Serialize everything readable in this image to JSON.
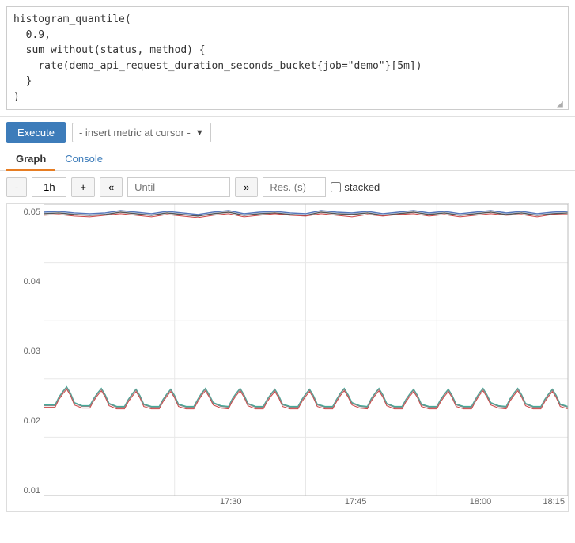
{
  "query": {
    "lines": [
      "histogram_quantile(",
      "  0.9,",
      "  sum without(status, method) {",
      "    rate(demo_api_request_duration_seconds_bucket{job=\"demo\"}[5m])",
      "  }",
      ")"
    ],
    "full_text": "histogram_quantile(\n  0.9,\n  sum without(status, method) {\n    rate(demo_api_request_duration_seconds_bucket{job=\"demo\"}[5m])\n  }\n)"
  },
  "toolbar": {
    "execute_label": "Execute",
    "metric_placeholder": "- insert metric at cursor -"
  },
  "tabs": [
    {
      "id": "graph",
      "label": "Graph",
      "active": true
    },
    {
      "id": "console",
      "label": "Console",
      "active": false
    }
  ],
  "graph_controls": {
    "minus_label": "-",
    "plus_label": "+",
    "rewind_label": "«",
    "forward_label": "»",
    "time_range": "1h",
    "until_placeholder": "Until",
    "res_placeholder": "Res. (s)",
    "stacked_label": "stacked"
  },
  "x_axis_labels": [
    "17:30",
    "17:45",
    "18:00",
    "18:15"
  ],
  "y_axis_labels": [
    "0.05",
    "0.04",
    "0.03",
    "0.02",
    "0.01"
  ],
  "colors": {
    "execute_bg": "#3d7cba",
    "tab_active_border": "#e77d22",
    "line1": "#555",
    "line2": "#c33",
    "line3": "#559",
    "line4": "#3a3",
    "line5": "#aaa",
    "grid": "#e8e8e8"
  }
}
